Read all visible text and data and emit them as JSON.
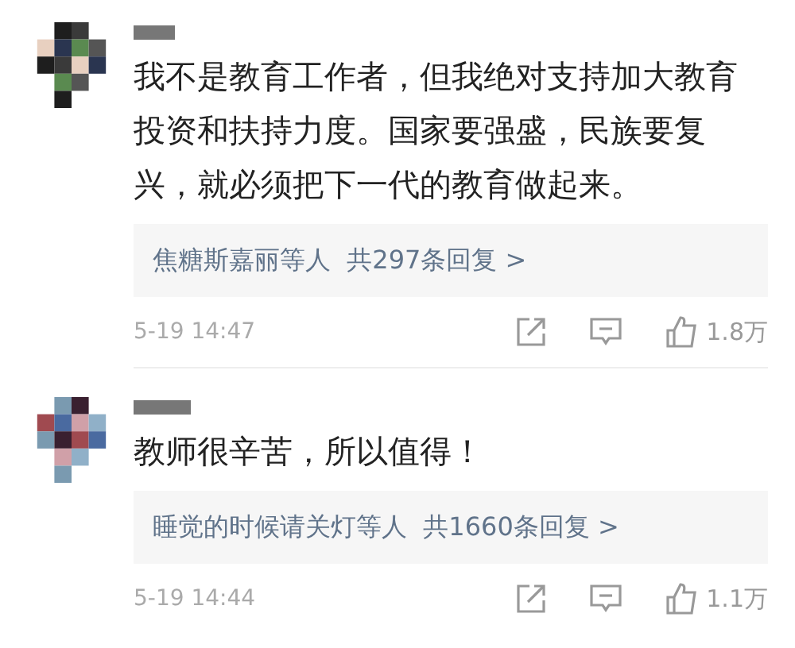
{
  "comments": [
    {
      "text": "我不是教育工作者，但我绝对支持加大教育投资和扶持力度。国家要强盛，民族要复兴，就必须把下一代的教育做起来。",
      "replies": "焦糖斯嘉丽等人  共297条回复 >",
      "time": "5-19 14:47",
      "likes": "1.8万"
    },
    {
      "text": "教师很辛苦，所以值得！",
      "replies": "睡觉的时候请关灯等人  共1660条回复 >",
      "time": "5-19 14:44",
      "likes": "1.1万"
    }
  ]
}
